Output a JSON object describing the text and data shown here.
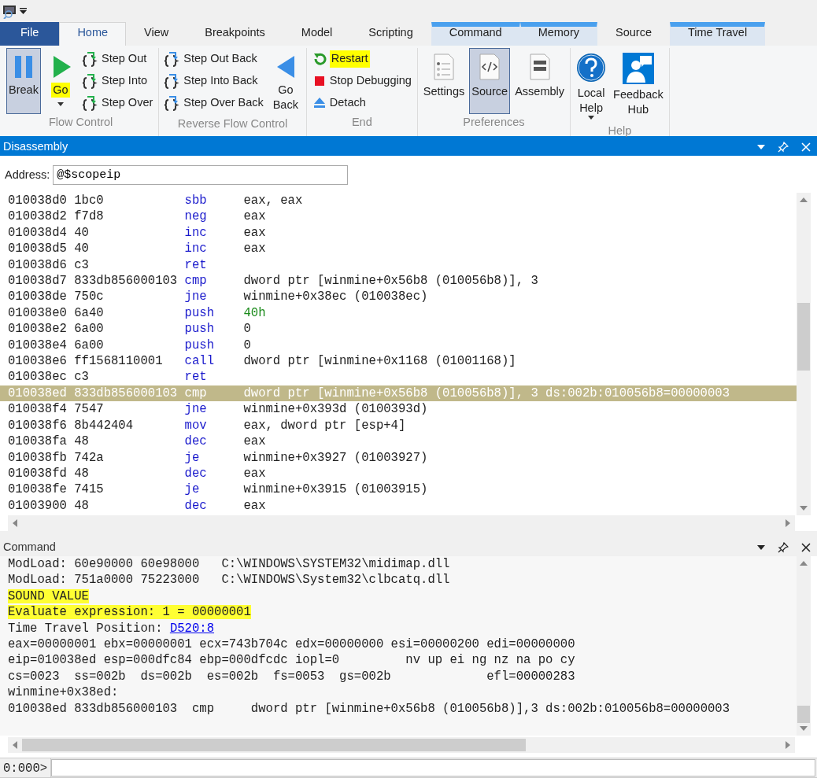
{
  "tabs": [
    {
      "label": "File",
      "kind": "file",
      "selected": false,
      "contextual": false
    },
    {
      "label": "Home",
      "kind": "tab",
      "selected": true,
      "contextual": false
    },
    {
      "label": "View",
      "kind": "tab",
      "selected": false,
      "contextual": false
    },
    {
      "label": "Breakpoints",
      "kind": "tab",
      "selected": false,
      "contextual": false
    },
    {
      "label": "Model",
      "kind": "tab",
      "selected": false,
      "contextual": false
    },
    {
      "label": "Scripting",
      "kind": "tab",
      "selected": false,
      "contextual": false
    },
    {
      "label": "Command",
      "kind": "tab",
      "selected": false,
      "contextual": true
    },
    {
      "label": "Memory",
      "kind": "tab",
      "selected": false,
      "contextual": true
    },
    {
      "label": "Source",
      "kind": "tab",
      "selected": false,
      "contextual": false
    },
    {
      "label": "Time Travel",
      "kind": "tab",
      "selected": false,
      "contextual": true
    }
  ],
  "ribbon_groups": [
    {
      "label": "Flow Control",
      "buttons": [
        {
          "label": "Break",
          "kind": "large",
          "pressed": true,
          "highlighted": false,
          "dropdown": false
        },
        {
          "label": "Go",
          "kind": "large",
          "pressed": false,
          "highlighted": true,
          "dropdown": true
        },
        {
          "label": "Step Out",
          "kind": "small",
          "pressed": false,
          "highlighted": false,
          "dropdown": false
        },
        {
          "label": "Step Into",
          "kind": "small",
          "pressed": false,
          "highlighted": false,
          "dropdown": false
        },
        {
          "label": "Step Over",
          "kind": "small",
          "pressed": false,
          "highlighted": false,
          "dropdown": false
        }
      ]
    },
    {
      "label": "Reverse Flow Control",
      "buttons": [
        {
          "label": "Step Out Back",
          "kind": "small",
          "pressed": false,
          "highlighted": false,
          "dropdown": false
        },
        {
          "label": "Step Into Back",
          "kind": "small",
          "pressed": false,
          "highlighted": false,
          "dropdown": false
        },
        {
          "label": "Step Over Back",
          "kind": "small",
          "pressed": false,
          "highlighted": false,
          "dropdown": false
        },
        {
          "label": "Go Back",
          "kind": "large",
          "pressed": false,
          "highlighted": false,
          "dropdown": false
        }
      ]
    },
    {
      "label": "End",
      "buttons": [
        {
          "label": "Restart",
          "kind": "small",
          "pressed": false,
          "highlighted": true,
          "dropdown": false
        },
        {
          "label": "Stop Debugging",
          "kind": "small",
          "pressed": false,
          "highlighted": false,
          "dropdown": false
        },
        {
          "label": "Detach",
          "kind": "small",
          "pressed": false,
          "highlighted": false,
          "dropdown": false
        }
      ]
    },
    {
      "label": "Preferences",
      "buttons": [
        {
          "label": "Settings",
          "kind": "large",
          "pressed": false,
          "highlighted": false,
          "dropdown": false
        },
        {
          "label": "Source",
          "kind": "large",
          "pressed": true,
          "highlighted": false,
          "dropdown": false
        },
        {
          "label": "Assembly",
          "kind": "large",
          "pressed": false,
          "highlighted": false,
          "dropdown": false
        }
      ]
    },
    {
      "label": "Help",
      "buttons": [
        {
          "label": "Local Help",
          "kind": "large",
          "pressed": false,
          "highlighted": false,
          "dropdown": true
        },
        {
          "label": "Feedback Hub",
          "kind": "large",
          "pressed": false,
          "highlighted": false,
          "dropdown": false
        }
      ]
    }
  ],
  "disassembly": {
    "title": "Disassembly",
    "active": true,
    "address_label": "Address:",
    "address_value": "@$scopeip",
    "rows": [
      {
        "address": "010038d0",
        "bytes": "1bc0",
        "mnemonic": "sbb",
        "operands": "eax, eax",
        "kind": "normal",
        "selected": false
      },
      {
        "address": "010038d2",
        "bytes": "f7d8",
        "mnemonic": "neg",
        "operands": "eax",
        "kind": "normal",
        "selected": false
      },
      {
        "address": "010038d4",
        "bytes": "40",
        "mnemonic": "inc",
        "operands": "eax",
        "kind": "normal",
        "selected": false
      },
      {
        "address": "010038d5",
        "bytes": "40",
        "mnemonic": "inc",
        "operands": "eax",
        "kind": "normal",
        "selected": false
      },
      {
        "address": "010038d6",
        "bytes": "c3",
        "mnemonic": "ret",
        "operands": "",
        "kind": "normal",
        "selected": false
      },
      {
        "address": "010038d7",
        "bytes": "833db856000103",
        "mnemonic": "cmp",
        "operands": "dword ptr [winmine+0x56b8 (010056b8)], 3",
        "kind": "normal",
        "selected": false
      },
      {
        "address": "010038de",
        "bytes": "750c",
        "mnemonic": "jne",
        "operands": "winmine+0x38ec (010038ec)",
        "kind": "normal",
        "selected": false
      },
      {
        "address": "010038e0",
        "bytes": "6a40",
        "mnemonic": "push",
        "operands": "40h",
        "kind": "literal",
        "selected": false
      },
      {
        "address": "010038e2",
        "bytes": "6a00",
        "mnemonic": "push",
        "operands": "0",
        "kind": "normal",
        "selected": false
      },
      {
        "address": "010038e4",
        "bytes": "6a00",
        "mnemonic": "push",
        "operands": "0",
        "kind": "normal",
        "selected": false
      },
      {
        "address": "010038e6",
        "bytes": "ff1568110001",
        "mnemonic": "call",
        "operands": "dword ptr [winmine+0x1168 (01001168)]",
        "kind": "normal",
        "selected": false
      },
      {
        "address": "010038ec",
        "bytes": "c3",
        "mnemonic": "ret",
        "operands": "",
        "kind": "normal",
        "selected": false
      },
      {
        "address": "010038ed",
        "bytes": "833db856000103",
        "mnemonic": "cmp",
        "operands": "dword ptr [winmine+0x56b8 (010056b8)], 3 ds:002b:010056b8=00000003",
        "kind": "normal",
        "selected": true
      },
      {
        "address": "010038f4",
        "bytes": "7547",
        "mnemonic": "jne",
        "operands": "winmine+0x393d (0100393d)",
        "kind": "normal",
        "selected": false
      },
      {
        "address": "010038f6",
        "bytes": "8b442404",
        "mnemonic": "mov",
        "operands": "eax, dword ptr [esp+4]",
        "kind": "normal",
        "selected": false
      },
      {
        "address": "010038fa",
        "bytes": "48",
        "mnemonic": "dec",
        "operands": "eax",
        "kind": "normal",
        "selected": false
      },
      {
        "address": "010038fb",
        "bytes": "742a",
        "mnemonic": "je",
        "operands": "winmine+0x3927 (01003927)",
        "kind": "normal",
        "selected": false
      },
      {
        "address": "010038fd",
        "bytes": "48",
        "mnemonic": "dec",
        "operands": "eax",
        "kind": "normal",
        "selected": false
      },
      {
        "address": "010038fe",
        "bytes": "7415",
        "mnemonic": "je",
        "operands": "winmine+0x3915 (01003915)",
        "kind": "normal",
        "selected": false
      },
      {
        "address": "01003900",
        "bytes": "48",
        "mnemonic": "dec",
        "operands": "eax",
        "kind": "normal",
        "selected": false
      }
    ]
  },
  "command": {
    "title": "Command",
    "active": false,
    "prompt": "0:000>",
    "lines": [
      {
        "kind": "plain",
        "text": "ModLoad: 60e90000 60e98000   C:\\WINDOWS\\SYSTEM32\\midimap.dll"
      },
      {
        "kind": "plain",
        "text": "ModLoad: 751a0000 75223000   C:\\WINDOWS\\System32\\clbcatq.dll"
      },
      {
        "kind": "marked",
        "text": "SOUND VALUE"
      },
      {
        "kind": "marked",
        "text": "Evaluate expression: 1 = 00000001"
      },
      {
        "kind": "link",
        "text": "Time Travel Position:",
        "link": "D520:8"
      },
      {
        "kind": "plain",
        "text": "eax=00000001 ebx=00000001 ecx=743b704c edx=00000000 esi=00000200 edi=00000000"
      },
      {
        "kind": "plain",
        "text": "eip=010038ed esp=000dfc84 ebp=000dfcdc iopl=0         nv up ei ng nz na po cy"
      },
      {
        "kind": "plain",
        "text": "cs=0023  ss=002b  ds=002b  es=002b  fs=0053  gs=002b             efl=00000283"
      },
      {
        "kind": "plain",
        "text": "winmine+0x38ed:"
      },
      {
        "kind": "plain",
        "text": "010038ed 833db856000103  cmp     dword ptr [winmine+0x56b8 (010056b8)],3 ds:002b:010056b8=00000003"
      }
    ]
  }
}
